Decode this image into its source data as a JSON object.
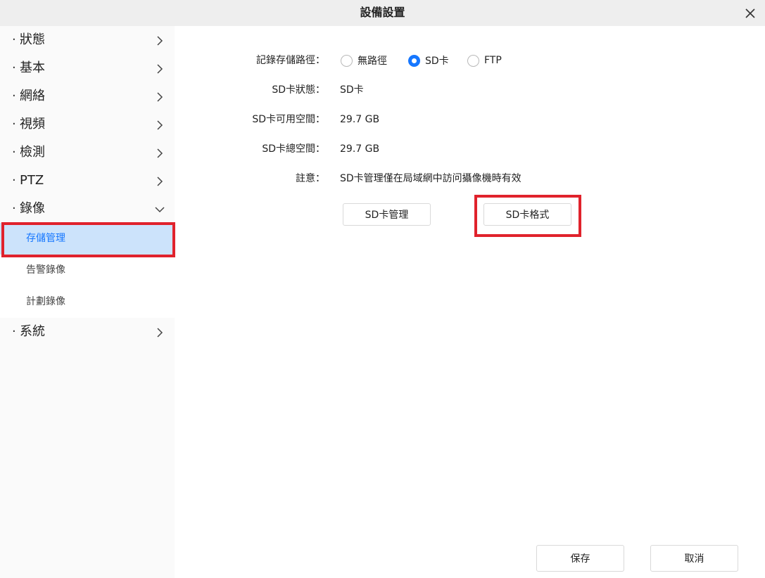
{
  "window": {
    "title": "設備設置",
    "close_icon": "close-icon"
  },
  "sidebar": {
    "items": [
      {
        "label": "狀態"
      },
      {
        "label": "基本"
      },
      {
        "label": "網絡"
      },
      {
        "label": "視頻"
      },
      {
        "label": "檢測"
      },
      {
        "label": "PTZ"
      },
      {
        "label": "錄像"
      },
      {
        "label": "系統"
      }
    ],
    "dot": "·",
    "record_subitems": [
      {
        "label": "存儲管理",
        "active": true
      },
      {
        "label": "告警錄像"
      },
      {
        "label": "計劃錄像"
      }
    ]
  },
  "form": {
    "storage_path_label": "記錄存儲路徑：",
    "storage_options": [
      {
        "label": "無路徑",
        "checked": false
      },
      {
        "label": "SD卡",
        "checked": true
      },
      {
        "label": "FTP",
        "checked": false
      }
    ],
    "sd_status_label": "SD卡狀態：",
    "sd_status_value": "SD卡",
    "sd_free_label": "SD卡可用空間：",
    "sd_free_value": "29.7 GB",
    "sd_total_label": "SD卡總空間：",
    "sd_total_value": "29.7 GB",
    "note_label": "註意：",
    "note_value": "SD卡管理僅在局域網中訪问攝像機時有效",
    "sd_manage_button": "SD卡管理",
    "sd_format_button": "SD卡格式"
  },
  "footer": {
    "save_button": "保存",
    "cancel_button": "取消"
  },
  "colors": {
    "accent": "#1677ff",
    "highlight": "#e0222c",
    "active_bg": "#cce3fb"
  }
}
